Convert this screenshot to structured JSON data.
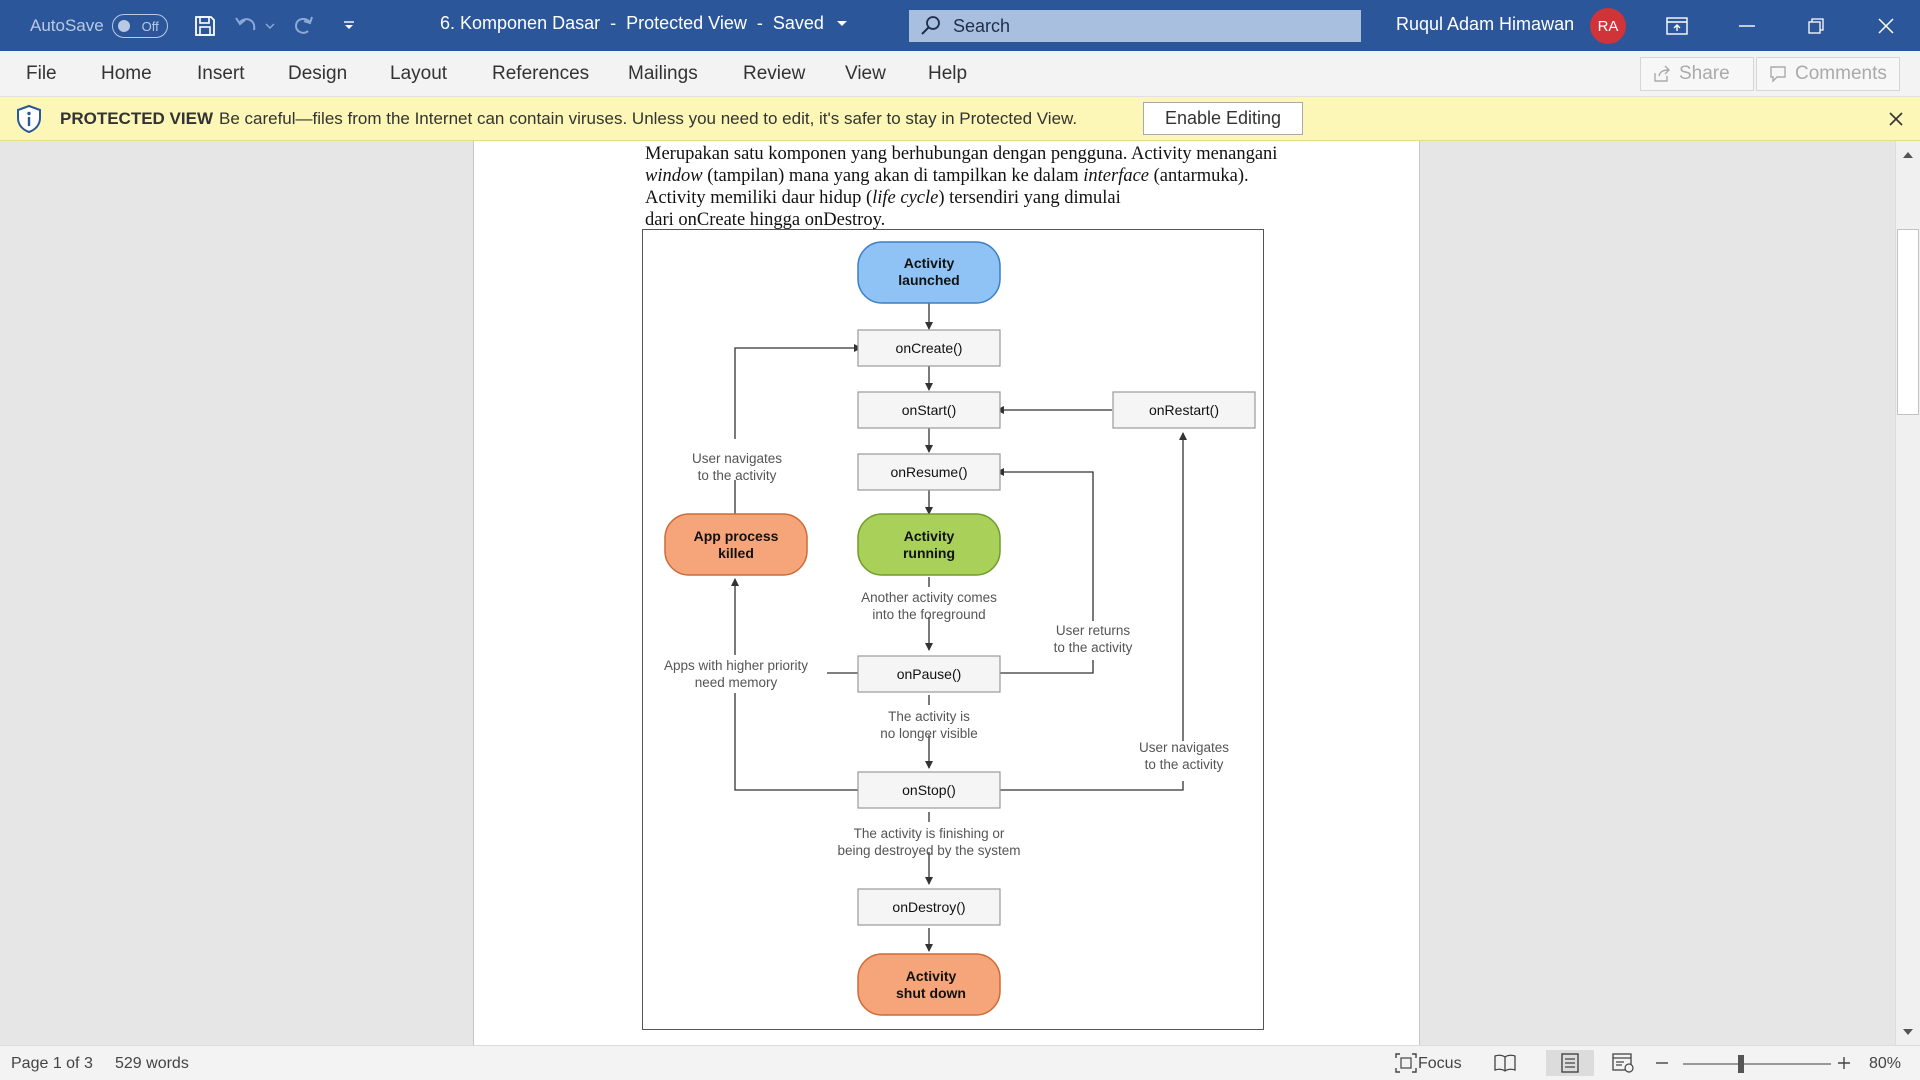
{
  "titlebar": {
    "autosave_label": "AutoSave",
    "autosave_state": "Off",
    "doc_name": "6. Komponen Dasar",
    "sep1": "-",
    "view_mode": "Protected View",
    "sep2": "-",
    "save_state": "Saved",
    "search_placeholder": "Search",
    "user_name": "Ruqul Adam Himawan",
    "user_initials": "RA"
  },
  "ribbon": {
    "tabs": [
      "File",
      "Home",
      "Insert",
      "Design",
      "Layout",
      "References",
      "Mailings",
      "Review",
      "View",
      "Help"
    ],
    "share_label": "Share",
    "comments_label": "Comments"
  },
  "protected_bar": {
    "title": "PROTECTED VIEW",
    "message": "Be careful—files from the Internet can contain viruses. Unless you need to edit, it's safer to stay in Protected View.",
    "button": "Enable Editing"
  },
  "document": {
    "line1": "Merupakan satu komponen yang berhubungan dengan pengguna. Activity menangani",
    "line2_a": "window",
    "line2_b": " (tampilan) mana yang akan di tampilkan ke dalam ",
    "line2_c": "interface",
    "line2_d": " (antarmuka).",
    "line3_a": "Activity memiliki daur hidup (",
    "line3_b": "life cycle",
    "line3_c": ") tersendiri yang dimulai",
    "line4": "dari onCreate hingga onDestroy."
  },
  "diagram": {
    "nodes": {
      "launched_1": "Activity",
      "launched_2": "launched",
      "oncreate": "onCreate()",
      "onstart": "onStart()",
      "onrestart": "onRestart()",
      "onresume": "onResume()",
      "running_1": "Activity",
      "running_2": "running",
      "killed_1": "App process",
      "killed_2": "killed",
      "onpause": "onPause()",
      "onstop": "onStop()",
      "ondestroy": "onDestroy()",
      "shutdown_1": "Activity",
      "shutdown_2": "shut down"
    },
    "labels": {
      "user_nav_left_1": "User navigates",
      "user_nav_left_2": "to the activity",
      "another_1": "Another activity comes",
      "another_2": "into the foreground",
      "returns_1": "User returns",
      "returns_2": "to the activity",
      "priority_1": "Apps with higher priority",
      "priority_2": "need memory",
      "novisible_1": "The activity is",
      "novisible_2": "no longer visible",
      "user_nav_right_1": "User navigates",
      "user_nav_right_2": "to the activity",
      "finishing_1": "The activity is finishing or",
      "finishing_2": "being destroyed by the system"
    },
    "colors": {
      "launched": "#8fc3f5",
      "running": "#a9d15a",
      "killed": "#f6a57a",
      "shutdown": "#f6a57a"
    }
  },
  "statusbar": {
    "page": "Page 1 of 3",
    "words": "529 words",
    "focus": "Focus",
    "zoom": "80%"
  }
}
